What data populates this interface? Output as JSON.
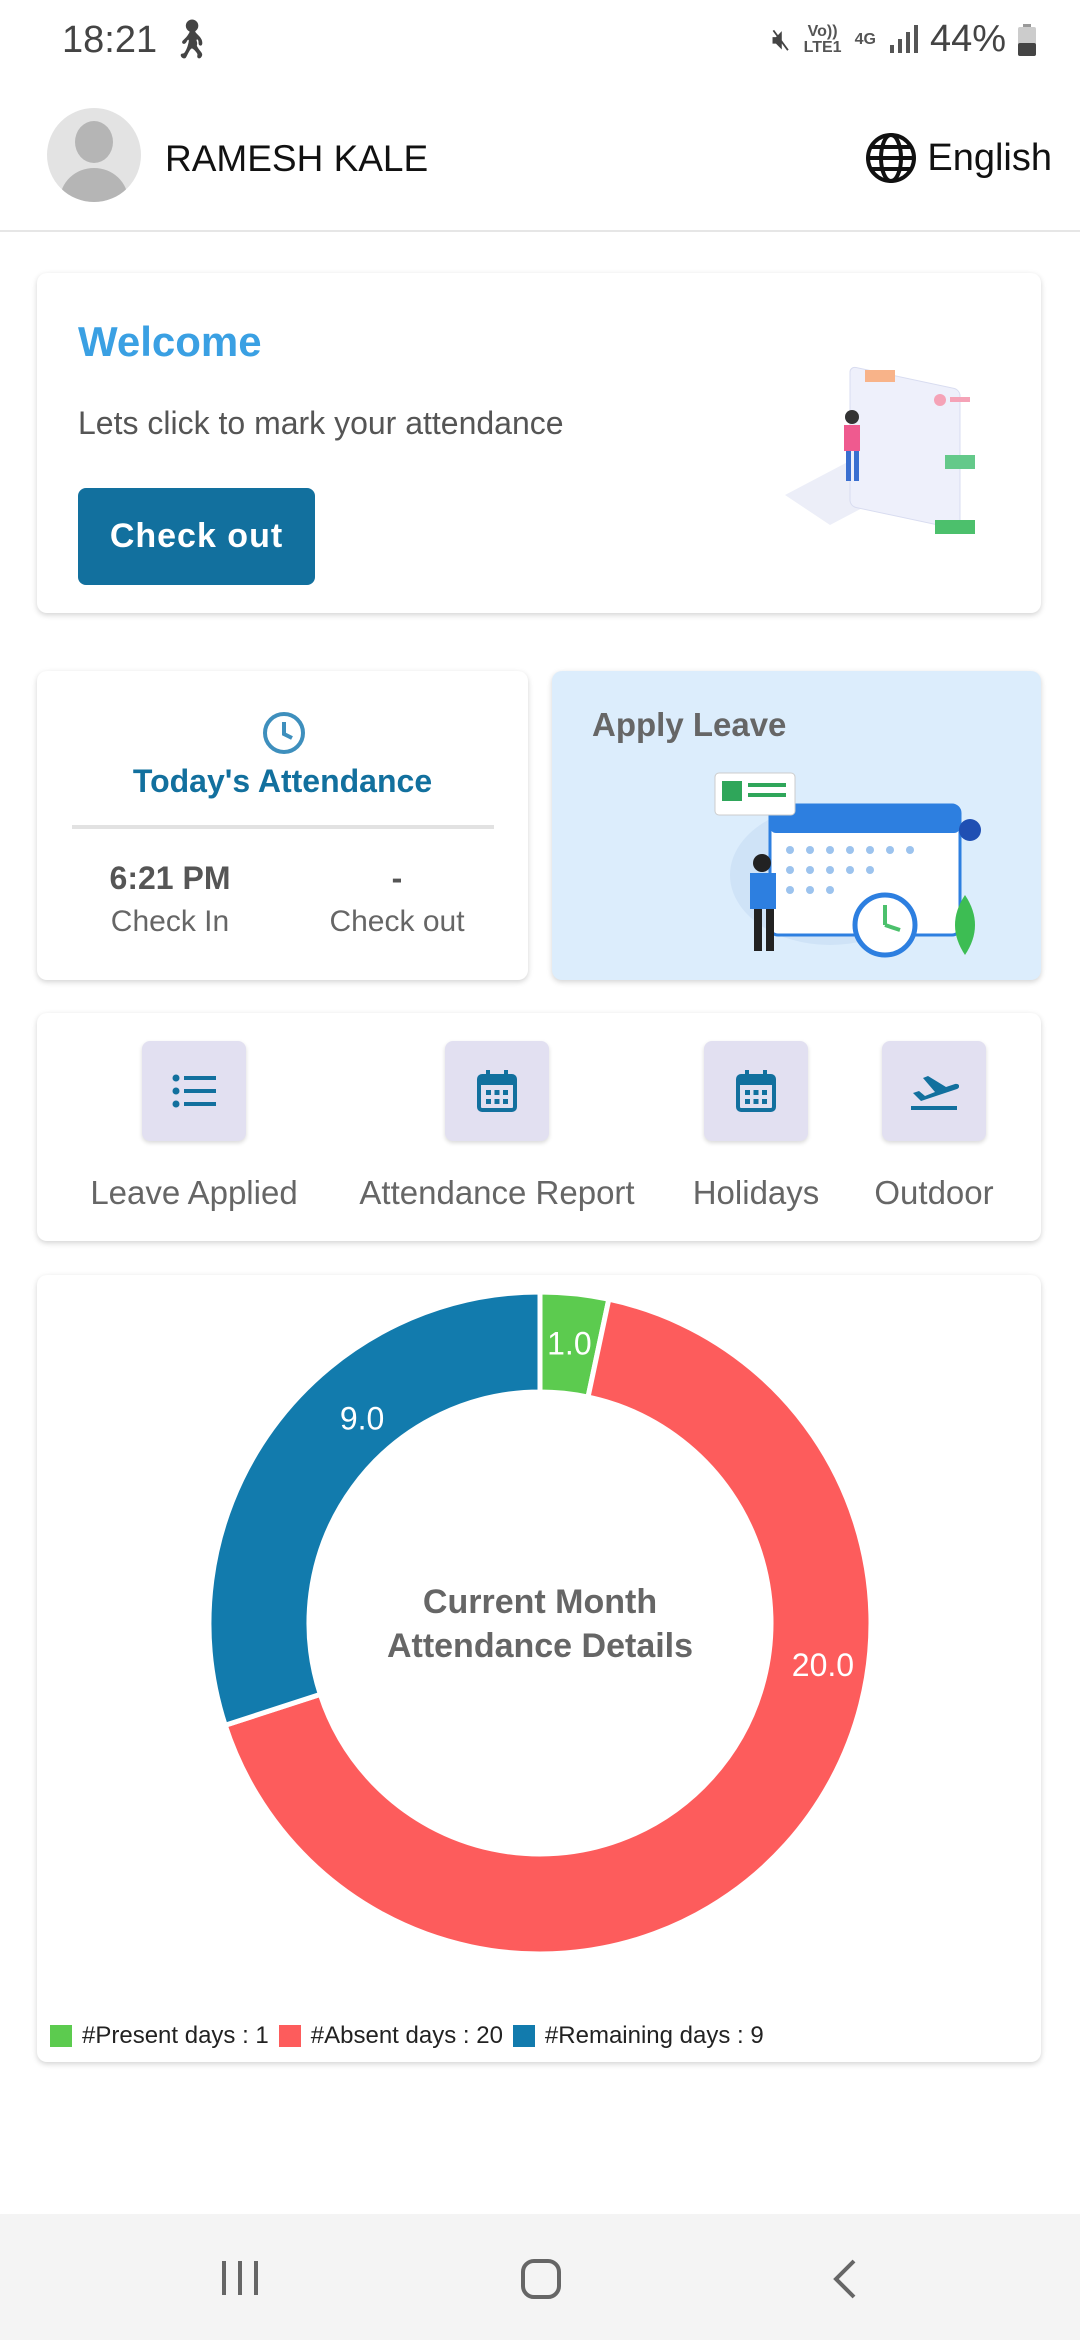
{
  "status_bar": {
    "time": "18:21",
    "battery": "44%",
    "network": "4G",
    "volte": "Vo)) LTE1"
  },
  "header": {
    "user_name": "RAMESH KALE",
    "language": "English"
  },
  "welcome": {
    "title": "Welcome",
    "subtitle": "Lets click to mark your attendance",
    "button": "Check out"
  },
  "attendance": {
    "title": "Today's Attendance",
    "check_in_time": "6:21 PM",
    "check_in_label": "Check In",
    "check_out_time": "-",
    "check_out_label": "Check out"
  },
  "apply_leave": {
    "title": "Apply Leave"
  },
  "quick_actions": [
    {
      "label": "Leave Applied",
      "icon": "list-icon"
    },
    {
      "label": "Attendance Report",
      "icon": "calendar-icon"
    },
    {
      "label": "Holidays",
      "icon": "calendar-icon"
    },
    {
      "label": "Outdoor",
      "icon": "flight-takeoff-icon"
    }
  ],
  "chart_data": {
    "type": "pie",
    "donut": true,
    "title": "Current Month Attendance Details",
    "categories": [
      "#Present days",
      "#Absent days",
      "#Remaining days"
    ],
    "values": [
      1,
      20,
      9
    ],
    "data_labels": [
      "1.0",
      "20.0",
      "9.0"
    ],
    "legend": [
      "#Present days : 1",
      "#Absent days : 20",
      "#Remaining days : 9"
    ],
    "colors": [
      "#5ccb4f",
      "#fd5c5c",
      "#127bad"
    ],
    "legend_position": "bottom-left"
  }
}
